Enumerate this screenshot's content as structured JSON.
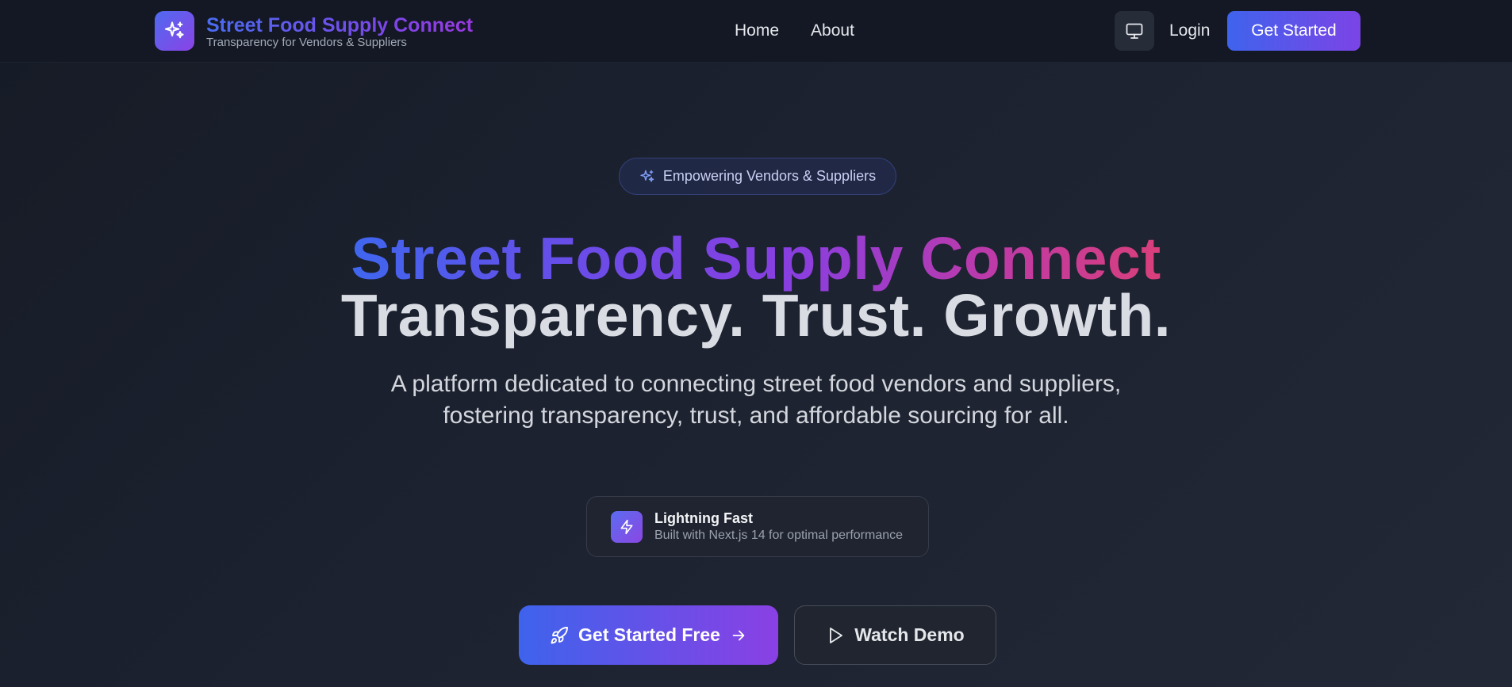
{
  "colors": {
    "accent_start": "#3f63ec",
    "accent_end": "#8a40e4",
    "background": "#1c2230",
    "navbar_bg": "#131824"
  },
  "header": {
    "brand_title": "Street Food Supply Connect",
    "brand_subtitle": "Transparency for Vendors & Suppliers",
    "logo_icon": "sparkles-icon",
    "nav": [
      {
        "label": "Home"
      },
      {
        "label": "About"
      }
    ],
    "display_toggle_icon": "monitor-icon",
    "login_label": "Login",
    "get_started_label": "Get Started"
  },
  "hero": {
    "badge_icon": "sparkles-icon",
    "badge_text": "Empowering Vendors & Suppliers",
    "headline_gradient": "Street Food Supply Connect",
    "headline_plain": "Transparency. Trust. Growth.",
    "description": "A platform dedicated to connecting street food vendors and suppliers, fostering transparency, trust, and affordable sourcing for all.",
    "feature": {
      "icon": "lightning-icon",
      "title": "Lightning Fast",
      "subtitle": "Built with Next.js 14 for optimal performance"
    },
    "cta_primary": {
      "label": "Get Started Free",
      "icon_left": "rocket-icon",
      "icon_right": "arrow-right-icon"
    },
    "cta_secondary": {
      "label": "Watch Demo",
      "icon_left": "play-icon"
    }
  }
}
